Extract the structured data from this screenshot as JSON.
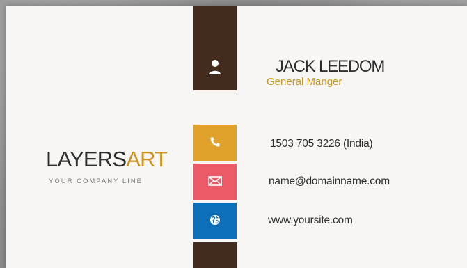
{
  "card": {
    "logo": {
      "part1": "LAYERS",
      "part2": "ART",
      "tagline": "YOUR COMPANY LINE"
    },
    "person": {
      "name": "JACK LEEDOM",
      "title": "General Manger"
    },
    "contacts": {
      "phone": "1503 705 3226 (India)",
      "email": "name@domainname.com",
      "website": "www.yoursite.com"
    },
    "icons": {
      "person": "user-icon",
      "phone": "phone-icon",
      "email": "mail-icon",
      "website": "globe-icon"
    }
  },
  "colors": {
    "brown": "#432c1d",
    "gold": "#e0a22b",
    "red": "#ea5a67",
    "blue": "#0c6fb7",
    "title_gold": "#c8951c",
    "logo_dark": "#2e2e2e",
    "logo_accent": "#c9931e"
  }
}
